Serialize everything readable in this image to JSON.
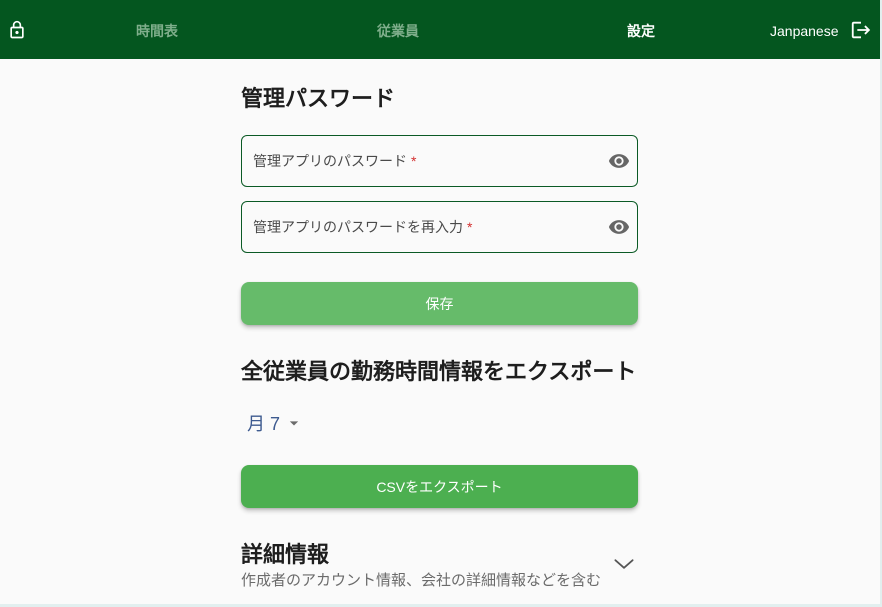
{
  "header": {
    "nav": [
      {
        "label": "時間表",
        "active": false
      },
      {
        "label": "従業員",
        "active": false
      },
      {
        "label": "設定",
        "active": true
      }
    ],
    "language": "Janpanese"
  },
  "password_section": {
    "title": "管理パスワード",
    "password_label": "管理アプリのパスワード",
    "confirm_label": "管理アプリのパスワードを再入力",
    "required_mark": "*",
    "save_label": "保存"
  },
  "export_section": {
    "title": "全従業員の勤務時間情報をエクスポート",
    "month_select": {
      "value": "月 7"
    },
    "export_label": "CSVをエクスポート"
  },
  "details_section": {
    "title": "詳細情報",
    "description": "作成者のアカウント情報、会社の詳細情報などを含む",
    "expanded": false
  },
  "icons": {
    "lock": "lock-icon",
    "logout": "logout-icon",
    "password_visibility": "eye-icon",
    "dropdown": "caret-down-icon",
    "expand": "chevron-down-icon"
  },
  "colors": {
    "header_bg": "#04561f",
    "nav_inactive": "#7fae8b",
    "nav_active": "#ffffff",
    "input_border": "#0b5a25",
    "save_button": "#66bb6a",
    "export_button": "#4caf50",
    "required_mark": "#d32f2f"
  }
}
